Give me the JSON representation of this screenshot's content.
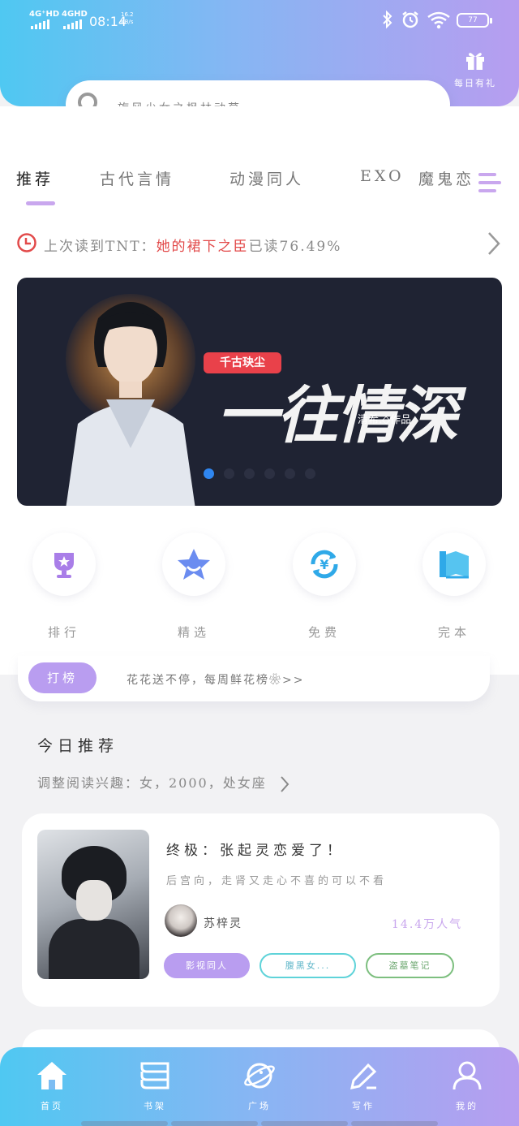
{
  "status_bar": {
    "network1": "4G⁺HD",
    "network2": "4GHD",
    "time": "08:14",
    "net_speed_value": "16.2",
    "net_speed_unit": "KB/s",
    "battery": "77"
  },
  "header": {
    "gift_label": "每日有礼",
    "search_placeholder": "旋风少女之枫林动草"
  },
  "categories": {
    "items": [
      "推荐",
      "古代言情",
      "动漫同人",
      "EXO",
      "魔鬼恋"
    ],
    "active": "推荐"
  },
  "last_read": {
    "prefix": "上次读到TNT：",
    "book": "她的裙下之臣",
    "suffix": "已读76.49%"
  },
  "banner": {
    "tag": "千古玦尘",
    "title": "一往情深",
    "author": "清希.◇作品",
    "slides": 6,
    "active_slide": 1
  },
  "quick_links": [
    {
      "label": "排行",
      "icon": "trophy-icon"
    },
    {
      "label": "精选",
      "icon": "star-icon"
    },
    {
      "label": "免费",
      "icon": "free-icon"
    },
    {
      "label": "完本",
      "icon": "book-icon"
    }
  ],
  "rank_strip": {
    "button": "打榜",
    "text": "花花送不停，每周鲜花榜❀>>"
  },
  "today": {
    "title": "今日推荐",
    "subtitle": "调整阅读兴趣：女，2000，处女座"
  },
  "book": {
    "title": "终极：张起灵恋爱了！",
    "desc": "后宫向，走肾又走心不喜的可以不看",
    "author": "苏梓灵",
    "popularity": "14.4万人气",
    "tags": [
      "影视同人",
      "腹黑女...",
      "盗墓笔记"
    ]
  },
  "bottom_nav": [
    "首页",
    "书架",
    "广场",
    "写作",
    "我的"
  ],
  "colors": {
    "accent_purple": "#b99df0",
    "accent_blue": "#4fc8f2",
    "highlight_red": "#e24a4a"
  }
}
